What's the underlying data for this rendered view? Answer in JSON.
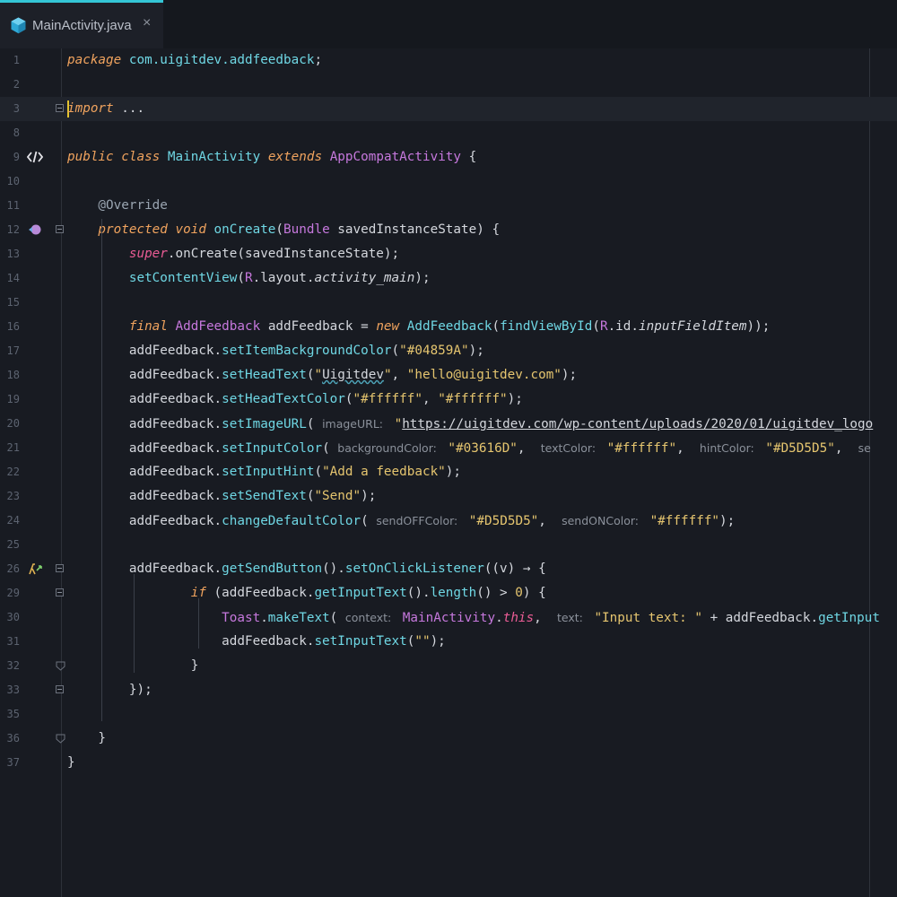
{
  "tab": {
    "title": "MainActivity.java",
    "close": "×",
    "icon": "java-class-cube-icon"
  },
  "colors": {
    "background": "#181b22",
    "tab_accent": "#34c6d6",
    "keyword": "#f0a35e",
    "type": "#c678dd",
    "function": "#6fd7e4",
    "string": "#e5c56f"
  },
  "lines": [
    {
      "n": "1",
      "segs": [
        [
          "kw",
          "package"
        ],
        [
          "fn",
          " com.uigitdev.addfeedback"
        ],
        [
          "",
          "; "
        ]
      ]
    },
    {
      "n": "2",
      "segs": []
    },
    {
      "n": "3",
      "segs": [
        [
          "kw",
          "import"
        ],
        [
          "",
          " ..."
        ]
      ]
    },
    {
      "n": "8",
      "segs": []
    },
    {
      "n": "9",
      "segs": [
        [
          "kw",
          "public class "
        ],
        [
          "fn",
          "MainActivity "
        ],
        [
          "kw",
          "extends "
        ],
        [
          "ty",
          "AppCompatActivity"
        ],
        [
          "",
          " {"
        ]
      ]
    },
    {
      "n": "10",
      "segs": []
    },
    {
      "n": "11",
      "segs": [
        [
          "an",
          "    @Override"
        ]
      ]
    },
    {
      "n": "12",
      "segs": [
        [
          "kw",
          "    protected void "
        ],
        [
          "fn",
          "onCreate"
        ],
        [
          "",
          "("
        ],
        [
          "ty",
          "Bundle "
        ],
        [
          "",
          "savedInstanceState) {"
        ]
      ]
    },
    {
      "n": "13",
      "segs": [
        [
          "pk",
          "        super"
        ],
        [
          "",
          ".onCreate(savedInstanceState);"
        ]
      ]
    },
    {
      "n": "14",
      "segs": [
        [
          "fn",
          "        setContentView"
        ],
        [
          "",
          "("
        ],
        [
          "ty",
          "R"
        ],
        [
          "",
          ".layout."
        ],
        [
          "it",
          "activity_main"
        ],
        [
          "",
          ");"
        ]
      ]
    },
    {
      "n": "15",
      "segs": []
    },
    {
      "n": "16",
      "segs": [
        [
          "kw",
          "        final "
        ],
        [
          "ty",
          "AddFeedback "
        ],
        [
          "",
          "addFeedback = "
        ],
        [
          "kw",
          "new "
        ],
        [
          "fn",
          "AddFeedback"
        ],
        [
          "",
          "("
        ],
        [
          "fn",
          "findViewById"
        ],
        [
          "",
          "("
        ],
        [
          "ty",
          "R"
        ],
        [
          "",
          ".id."
        ],
        [
          "it",
          "inputFieldItem"
        ],
        [
          "",
          "));"
        ]
      ]
    },
    {
      "n": "17",
      "segs": [
        [
          "",
          "        addFeedback."
        ],
        [
          "fn",
          "setItemBackgroundColor"
        ],
        [
          "",
          "("
        ],
        [
          "st",
          "\"#04859A\""
        ],
        [
          "",
          ");"
        ]
      ]
    },
    {
      "n": "18",
      "segs": [
        [
          "",
          "        addFeedback."
        ],
        [
          "fn",
          "setHeadText"
        ],
        [
          "",
          "("
        ],
        [
          "st",
          "\""
        ],
        [
          "wavy",
          "Uigitdev"
        ],
        [
          "st",
          "\""
        ],
        [
          "",
          ", "
        ],
        [
          "st",
          "\"hello@uigitdev.com\""
        ],
        [
          "",
          ");"
        ]
      ]
    },
    {
      "n": "19",
      "segs": [
        [
          "",
          "        addFeedback."
        ],
        [
          "fn",
          "setHeadTextColor"
        ],
        [
          "",
          "("
        ],
        [
          "st",
          "\"#ffffff\""
        ],
        [
          "",
          ", "
        ],
        [
          "st",
          "\"#ffffff\""
        ],
        [
          "",
          ");"
        ]
      ]
    },
    {
      "n": "20",
      "segs": [
        [
          "",
          "        addFeedback."
        ],
        [
          "fn",
          "setImageURL"
        ],
        [
          "",
          "( "
        ],
        [
          "hint",
          "imageURL: "
        ],
        [
          "st",
          " \""
        ],
        [
          "ul",
          "https://uigitdev.com/wp-content/uploads/2020/01/uigitdev_logo"
        ]
      ]
    },
    {
      "n": "21",
      "segs": [
        [
          "",
          "        addFeedback."
        ],
        [
          "fn",
          "setInputColor"
        ],
        [
          "",
          "( "
        ],
        [
          "hint",
          "backgroundColor: "
        ],
        [
          "st",
          " \"#03616D\""
        ],
        [
          "",
          ",  "
        ],
        [
          "hint",
          "textColor: "
        ],
        [
          "st",
          " \"#ffffff\""
        ],
        [
          "",
          ",  "
        ],
        [
          "hint",
          "hintColor: "
        ],
        [
          "st",
          " \"#D5D5D5\""
        ],
        [
          "",
          ",  "
        ],
        [
          "hint",
          "se"
        ]
      ]
    },
    {
      "n": "22",
      "segs": [
        [
          "",
          "        addFeedback."
        ],
        [
          "fn",
          "setInputHint"
        ],
        [
          "",
          "("
        ],
        [
          "st",
          "\"Add a feedback\""
        ],
        [
          "",
          ");"
        ]
      ]
    },
    {
      "n": "23",
      "segs": [
        [
          "",
          "        addFeedback."
        ],
        [
          "fn",
          "setSendText"
        ],
        [
          "",
          "("
        ],
        [
          "st",
          "\"Send\""
        ],
        [
          "",
          ");"
        ]
      ]
    },
    {
      "n": "24",
      "segs": [
        [
          "",
          "        addFeedback."
        ],
        [
          "fn",
          "changeDefaultColor"
        ],
        [
          "",
          "( "
        ],
        [
          "hint",
          "sendOFFColor: "
        ],
        [
          "st",
          " \"#D5D5D5\""
        ],
        [
          "",
          ",  "
        ],
        [
          "hint",
          "sendONColor: "
        ],
        [
          "st",
          " \"#ffffff\""
        ],
        [
          "",
          ");"
        ]
      ]
    },
    {
      "n": "25",
      "segs": []
    },
    {
      "n": "26",
      "segs": [
        [
          "",
          "        addFeedback."
        ],
        [
          "fn",
          "getSendButton"
        ],
        [
          "",
          "()."
        ],
        [
          "fn",
          "setOnClickListener"
        ],
        [
          "",
          "((v) → {"
        ]
      ]
    },
    {
      "n": "29",
      "segs": [
        [
          "kw",
          "                if "
        ],
        [
          "",
          "(addFeedback."
        ],
        [
          "fn",
          "getInputText"
        ],
        [
          "",
          "()."
        ],
        [
          "fn",
          "length"
        ],
        [
          "",
          "() > "
        ],
        [
          "st",
          "0"
        ],
        [
          "",
          ") {"
        ]
      ]
    },
    {
      "n": "30",
      "segs": [
        [
          "ty",
          "                    Toast"
        ],
        [
          "",
          "."
        ],
        [
          "fn",
          "makeText"
        ],
        [
          "",
          "( "
        ],
        [
          "hint",
          "context: "
        ],
        [
          "ty",
          " MainActivity"
        ],
        [
          "",
          "."
        ],
        [
          "pk",
          "this"
        ],
        [
          "",
          ",  "
        ],
        [
          "hint",
          "text: "
        ],
        [
          "st",
          " \"Input text: \""
        ],
        [
          "",
          " + addFeedback."
        ],
        [
          "fn",
          "getInput"
        ]
      ]
    },
    {
      "n": "31",
      "segs": [
        [
          "",
          "                    addFeedback."
        ],
        [
          "fn",
          "setInputText"
        ],
        [
          "",
          "("
        ],
        [
          "st",
          "\"\""
        ],
        [
          "",
          ");"
        ]
      ]
    },
    {
      "n": "32",
      "segs": [
        [
          "",
          "                }"
        ]
      ]
    },
    {
      "n": "33",
      "segs": [
        [
          "",
          "        });"
        ]
      ]
    },
    {
      "n": "35",
      "segs": []
    },
    {
      "n": "36",
      "segs": [
        [
          "",
          "    }"
        ]
      ]
    },
    {
      "n": "37",
      "segs": [
        [
          "",
          "}"
        ]
      ]
    }
  ]
}
